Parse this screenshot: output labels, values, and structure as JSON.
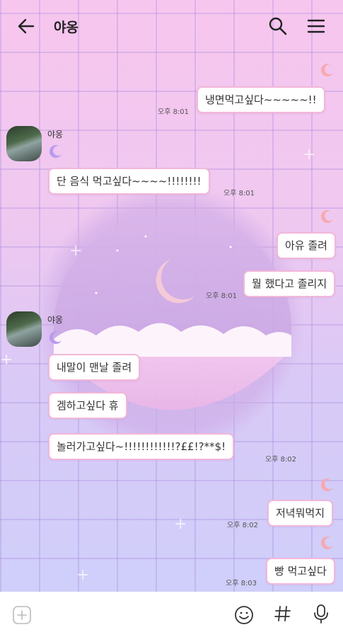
{
  "header": {
    "title": "야옹",
    "back_icon": "arrow-left-icon",
    "search_icon": "search-icon",
    "menu_icon": "hamburger-menu-icon"
  },
  "messages": [
    {
      "side": "right",
      "text": "냉면먹고싶다~~~~~!!",
      "time": "오후 8:01"
    },
    {
      "side": "left",
      "sender": "야옹",
      "text": "단 음식 먹고싶다~~~~!!!!!!!!",
      "time": "오후 8:01"
    },
    {
      "side": "right",
      "text": "아유 졸려",
      "time": ""
    },
    {
      "side": "right",
      "text": "뭘 했다고 졸리지",
      "time": "오후 8:01"
    },
    {
      "side": "left",
      "sender": "야옹",
      "text": "내말이 맨날 졸려",
      "time": ""
    },
    {
      "side": "left",
      "text": "겜하고싶다 휴",
      "time": ""
    },
    {
      "side": "left",
      "text": "놀러가고싶다~!!!!!!!!!!!!?££!?**$!",
      "time": "오후 8:02"
    },
    {
      "side": "right",
      "text": "저녁뭐먹지",
      "time": "오후 8:02"
    },
    {
      "side": "right",
      "text": "빵 먹고싶다",
      "time": "오후 8:03"
    }
  ],
  "input_bar": {
    "plus_icon": "plus-icon",
    "emoji_icon": "emoji-icon",
    "hash_icon": "hash-icon",
    "mic_icon": "microphone-icon"
  },
  "colors": {
    "bubble_border": "#f2b7d9",
    "bg_top": "#f7c6ee",
    "bg_bottom": "#cdd0fb"
  }
}
